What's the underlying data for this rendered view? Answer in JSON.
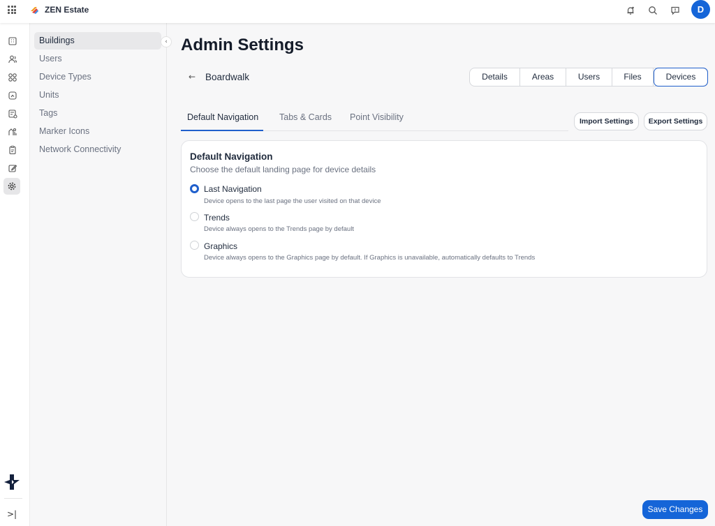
{
  "app": {
    "brand_name": "ZEN Estate",
    "avatar_initial": "D",
    "accent_color": "#1565d8"
  },
  "topbar": {
    "icons": [
      "apps-grid-icon",
      "bell-icon",
      "search-icon",
      "feedback-icon"
    ]
  },
  "rail": {
    "icons": [
      "building-icon",
      "users-icon",
      "device-types-icon",
      "units-icon",
      "tags-icon",
      "marker-icon",
      "clipboard-icon",
      "edit-icon",
      "gear-icon"
    ],
    "active": "gear-icon"
  },
  "subnav": {
    "items": [
      {
        "label": "Buildings",
        "active": true
      },
      {
        "label": "Users"
      },
      {
        "label": "Device Types"
      },
      {
        "label": "Units"
      },
      {
        "label": "Tags"
      },
      {
        "label": "Marker Icons"
      },
      {
        "label": "Network Connectivity"
      }
    ]
  },
  "main": {
    "title": "Admin Settings",
    "building": "Boardwalk",
    "segments": [
      {
        "label": "Details"
      },
      {
        "label": "Areas"
      },
      {
        "label": "Users"
      },
      {
        "label": "Files"
      },
      {
        "label": "Devices",
        "active": true
      }
    ],
    "tabs": [
      {
        "label": "Default Navigation",
        "active": true
      },
      {
        "label": "Tabs & Cards"
      },
      {
        "label": "Point Visibility"
      }
    ],
    "import_label": "Import Settings",
    "export_label": "Export Settings",
    "card": {
      "title": "Default Navigation",
      "subtitle": "Choose the default landing page for device details",
      "options": [
        {
          "label": "Last Navigation",
          "desc": "Device opens to the last page the user visited on that device",
          "checked": true
        },
        {
          "label": "Trends",
          "desc": "Device always opens to the Trends page by default",
          "checked": false
        },
        {
          "label": "Graphics",
          "desc": "Device always opens to the Graphics page by default. If Graphics is unavailable, automatically defaults to Trends",
          "checked": false
        }
      ]
    },
    "save_label": "Save Changes"
  }
}
